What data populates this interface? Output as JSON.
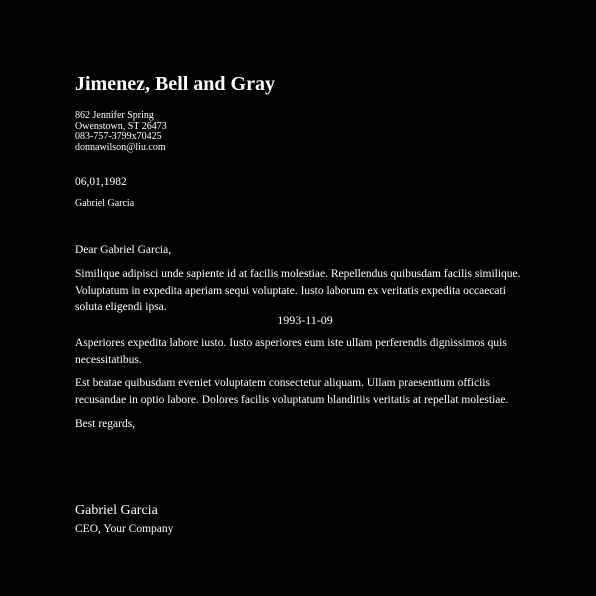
{
  "letter": {
    "company_name": "Jimenez, Bell and Gray",
    "address": {
      "street": "862 Jennifer Spring",
      "city_state_zip": "Owenstown, ST 26473",
      "phone": "083-757-3799x70425",
      "email": "donnawilson@liu.com"
    },
    "date": "06,01,1982",
    "recipient": "Gabriel Garcia",
    "salutation": "Dear Gabriel Garcia,",
    "paragraph_1": "Similique adipisci unde sapiente id at facilis molestiae. Repellendus quibusdam facilis similique. Voluptatum in expedita aperiam sequi voluptate. Iusto laborum ex veritatis expedita occaecati soluta eligendi ipsa.",
    "centered_date": "1993-11-09",
    "paragraph_2": "Asperiores expedita labore iusto. Iusto asperiores eum iste ullam perferendis dignissimos quis necessitatibus.",
    "paragraph_3": "Est beatae quibusdam eveniet voluptatem consectetur aliquam. Ullam praesentium officiis recusandae in optio labore. Dolores facilis voluptatum blanditiis veritatis at repellat molestiae.",
    "closing": "Best regards,",
    "signature_name": "Gabriel Garcia",
    "signature_title": "CEO, Your Company"
  },
  "colors": {
    "background": "#000000",
    "text": "#ffffff"
  }
}
